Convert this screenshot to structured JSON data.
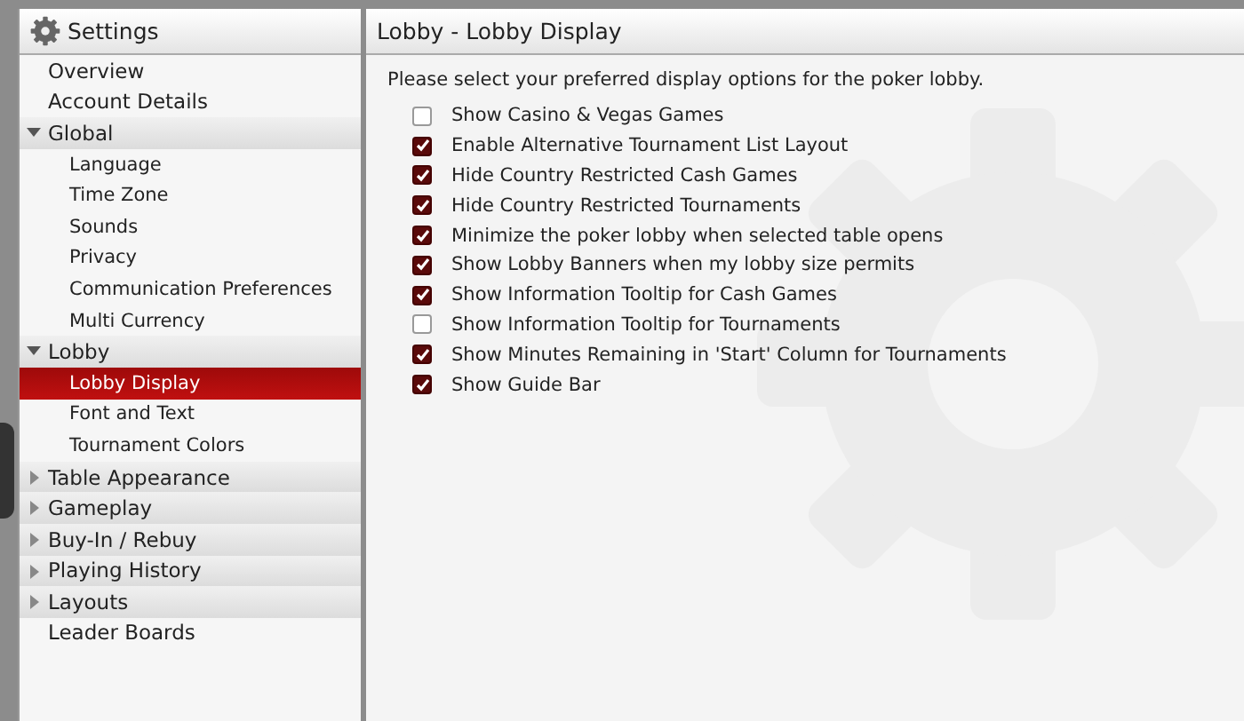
{
  "sidebar": {
    "title": "Settings",
    "items": [
      {
        "kind": "link",
        "label": "Overview",
        "selected": false
      },
      {
        "kind": "link",
        "label": "Account Details",
        "selected": false
      },
      {
        "kind": "group",
        "label": "Global",
        "expanded": true,
        "children": [
          {
            "label": "Language",
            "selected": false
          },
          {
            "label": "Time Zone",
            "selected": false
          },
          {
            "label": "Sounds",
            "selected": false
          },
          {
            "label": "Privacy",
            "selected": false
          },
          {
            "label": "Communication Preferences",
            "selected": false
          },
          {
            "label": "Multi Currency",
            "selected": false
          }
        ]
      },
      {
        "kind": "group",
        "label": "Lobby",
        "expanded": true,
        "children": [
          {
            "label": "Lobby Display",
            "selected": true
          },
          {
            "label": "Font and Text",
            "selected": false
          },
          {
            "label": "Tournament Colors",
            "selected": false
          }
        ]
      },
      {
        "kind": "group",
        "label": "Table Appearance",
        "expanded": false
      },
      {
        "kind": "group",
        "label": "Gameplay",
        "expanded": false
      },
      {
        "kind": "group",
        "label": "Buy-In / Rebuy",
        "expanded": false
      },
      {
        "kind": "group",
        "label": "Playing History",
        "expanded": false
      },
      {
        "kind": "group",
        "label": "Layouts",
        "expanded": false
      },
      {
        "kind": "link",
        "label": "Leader Boards",
        "selected": false
      }
    ]
  },
  "content": {
    "title": "Lobby - Lobby Display",
    "intro": "Please select your preferred display options for the poker lobby.",
    "options": [
      {
        "label": "Show Casino & Vegas Games",
        "checked": false
      },
      {
        "label": "Enable Alternative Tournament List Layout",
        "checked": true
      },
      {
        "label": "Hide Country Restricted Cash Games",
        "checked": true
      },
      {
        "label": "Hide Country Restricted Tournaments",
        "checked": true
      },
      {
        "label": "Minimize the poker lobby when selected table opens",
        "checked": true
      },
      {
        "label": "Show Lobby Banners when my lobby size permits",
        "checked": true
      },
      {
        "label": "Show Information Tooltip for Cash Games",
        "checked": true
      },
      {
        "label": "Show Information Tooltip for Tournaments",
        "checked": false
      },
      {
        "label": "Show Minutes Remaining in 'Start' Column for Tournaments",
        "checked": true
      },
      {
        "label": "Show Guide Bar",
        "checked": true
      }
    ]
  }
}
